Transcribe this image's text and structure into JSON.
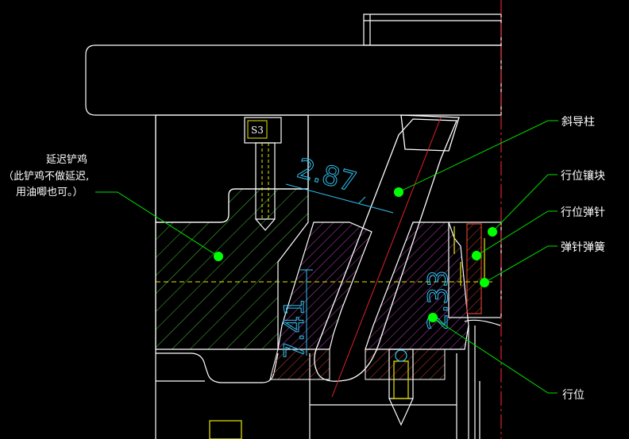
{
  "drawing": {
    "background": "#000000",
    "colors": {
      "outline": "#ffffff",
      "hatch": "#4cc43c",
      "magenta_hatch": "#c040c0",
      "red_hatch": "#d04030",
      "centerline": "#e0202c",
      "dimension": "#2ec4f0",
      "leader": "#00e000",
      "marker": "#00ff00",
      "yellow": "#e8e800"
    },
    "screw_tag": "S3",
    "dimensions": {
      "heel_angle": "2.87",
      "slider_angle": "2.33",
      "travel": "7.41"
    },
    "labels": {
      "delay_heel_line1": "延迟铲鸡",
      "delay_heel_line2": "（此铲鸡不做延迟,",
      "delay_heel_line3": "用油唧也可。）",
      "angle_pin": "斜导柱",
      "slider_insert": "行位镶块",
      "slider_ejector_pin": "行位弹针",
      "ejector_spring": "弹针弹簧",
      "slider": "行位"
    }
  }
}
